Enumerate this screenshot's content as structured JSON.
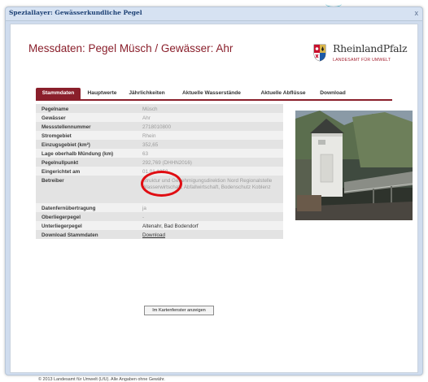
{
  "window": {
    "title": "Speziallayer: Gewässerkundliche Pegel",
    "close_glyph": "x"
  },
  "heading": "Messdaten: Pegel Müsch / Gewässer: Ahr",
  "logo": {
    "name": "RheinlandPfalz",
    "subtitle": "LANDESAMT FÜR UMWELT"
  },
  "tabs": [
    {
      "label": "Stammdaten",
      "active": true
    },
    {
      "label": "Hauptwerte",
      "active": false
    },
    {
      "label": "Jährlichkeiten",
      "active": false
    },
    {
      "label": "Aktuelle Wasserstände",
      "active": false
    },
    {
      "label": "Aktuelle Abflüsse",
      "active": false
    },
    {
      "label": "Download",
      "active": false
    }
  ],
  "rows": [
    {
      "label": "Pegelname",
      "value": "Müsch"
    },
    {
      "label": "Gewässer",
      "value": "Ahr"
    },
    {
      "label": "Messstellennummer",
      "value": "2718010800"
    },
    {
      "label": "Stromgebiet",
      "value": "Rhein"
    },
    {
      "label": "Einzugsgebiet (km²)",
      "value": "352,65"
    },
    {
      "label": "Lage oberhalb Mündung (km)",
      "value": "63"
    },
    {
      "label": "Pegelnullpunkt",
      "value": "292,769 (DHHN2016)"
    },
    {
      "label": "Eingerichtet am",
      "value": "01.01.1952"
    },
    {
      "label": "Betreiber",
      "value": "Struktur und Genehmigungsdirektion Nord Regionalstelle Wasserwirtschaft, Abfallwirtschaft, Bodenschutz Koblenz"
    },
    {
      "label": "Datenfernübertragung",
      "value": "ja"
    },
    {
      "label": "Oberliegerpegel",
      "value": "-"
    },
    {
      "label": "Unterliegerpegel",
      "value": "Altenahr, Bad Bodendorf"
    },
    {
      "label": "Download Stammdaten",
      "value": "Download"
    }
  ],
  "map_button": "Im Kartenfenster anzeigen",
  "footer": "© 2013 Landesamt für Umwelt (LfU). Alle Angaben ohne Gewähr.",
  "colors": {
    "accent": "#8a1f2b",
    "highlight_circle": "#e00d12"
  }
}
